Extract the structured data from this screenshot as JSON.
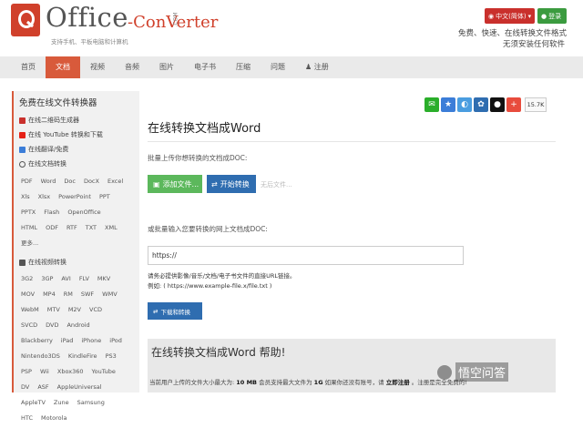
{
  "header": {
    "logo_office": "Office",
    "logo_conv": "-ConVerter",
    "logo_com": ".COM",
    "logo_sub": "支持手机、平板电脑和计算机",
    "lang_label": "中文(简体)",
    "login_label": "登录",
    "tagline1": "免费、快速、在线转换文件格式",
    "tagline2": "无须安装任何软件"
  },
  "nav": {
    "items": [
      "首页",
      "文档",
      "视频",
      "音频",
      "图片",
      "电子书",
      "压缩",
      "问题",
      "注册"
    ],
    "active_index": 1
  },
  "sidebar": {
    "title": "免费在线文件转换器",
    "links": [
      "在线二维码生成器",
      "在线 YouTube 转换和下载",
      "在线翻译/免费",
      "在线文档转换"
    ],
    "doc_formats": [
      "PDF",
      "Word",
      "Doc",
      "DocX",
      "Excel",
      "Xls",
      "Xlsx",
      "PowerPoint",
      "PPT",
      "PPTX",
      "Flash",
      "OpenOffice",
      "HTML",
      "ODF",
      "RTF",
      "TXT",
      "XML",
      "更多..."
    ],
    "video_label": "在线视频转换",
    "video_formats": [
      "3G2",
      "3GP",
      "AVI",
      "FLV",
      "MKV",
      "MOV",
      "MP4",
      "RM",
      "SWF",
      "WMV",
      "WebM",
      "MTV",
      "M2V",
      "VCD",
      "SVCD",
      "DVD",
      "Android",
      "Blackberry",
      "iPad",
      "iPhone",
      "iPod",
      "Nintendo3DS",
      "KindleFire",
      "PS3",
      "PSP",
      "Wii",
      "Xbox360",
      "YouTube",
      "DV",
      "ASF",
      "AppleUniversal",
      "AppleTV",
      "Zune",
      "Samsung",
      "HTC",
      "Motorola"
    ]
  },
  "share": {
    "count": "15.7K"
  },
  "main": {
    "title": "在线转换文档成Word",
    "batch_label": "批量上传你想转换的文档成DOC:",
    "add_files": "添加文件...",
    "start_convert": "开始转换",
    "no_file": "无后文件...",
    "url_label": "或批量输入您要转换的网上文档成DOC:",
    "url_value": "https://",
    "note1": "请务必提供影像/音乐/文档/电子书文件的直接URL链接。",
    "note2": "例如: ( https://www.example-file.x/file.txt )",
    "download_convert": "下载和转换"
  },
  "help": {
    "title": "在线转换文档成Word 帮助!",
    "text_a": "当前用户上传的文件大小最大为:",
    "size_free": "10 MB",
    "text_b": "会员支持最大文件为",
    "size_member": "1G",
    "text_c": "如果你还没有账号，请",
    "register_now": "立即注册",
    "text_d": "。注册是完全免费的!"
  },
  "watermark": {
    "text": "悟空问答"
  },
  "colors": {
    "accent": "#d85a3b",
    "blue": "#2f6db0",
    "green": "#5cb85c"
  }
}
